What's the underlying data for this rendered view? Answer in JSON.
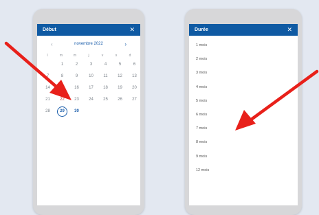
{
  "calendar_dialog": {
    "title": "Début",
    "close_icon": "close-icon",
    "month_label": "novembre 2022",
    "prev_icon": "chevron-left-icon",
    "next_icon": "chevron-right-icon",
    "weekdays": [
      "l",
      "m",
      "m",
      "j",
      "v",
      "s",
      "d"
    ],
    "days": [
      "",
      "1",
      "2",
      "3",
      "4",
      "5",
      "6",
      "7",
      "8",
      "9",
      "10",
      "11",
      "12",
      "13",
      "14",
      "15",
      "16",
      "17",
      "18",
      "19",
      "20",
      "21",
      "22",
      "23",
      "24",
      "25",
      "26",
      "27",
      "28",
      "29",
      "30",
      "",
      "",
      "",
      ""
    ],
    "selected_day": "29",
    "accent_color": "#1b5eab",
    "header_color": "#0f5aa3"
  },
  "duration_dialog": {
    "title": "Durée",
    "close_icon": "close-icon",
    "options": [
      "1 mois",
      "2 mois",
      "3 mois",
      "4 mois",
      "5 mois",
      "6 mois",
      "7 mois",
      "8 mois",
      "9 mois",
      "12 mois"
    ]
  },
  "annotations": {
    "arrow_color": "#e8201a"
  }
}
